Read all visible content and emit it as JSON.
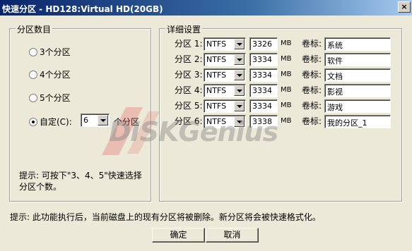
{
  "window": {
    "title": "快速分区 - HD128:Virtual HD(20GB)",
    "close_label": "×"
  },
  "left_group": {
    "title": "分区数目",
    "options": [
      {
        "label": "3个分区",
        "checked": false
      },
      {
        "label": "4个分区",
        "checked": false
      },
      {
        "label": "5个分区",
        "checked": false
      },
      {
        "label": "自定(C):",
        "checked": true
      }
    ],
    "custom_count": "6",
    "custom_suffix": "个分区",
    "hint_line1": "提示: 可按下\"3、4、5\"快速选择",
    "hint_line2": "分区个数。"
  },
  "right_group": {
    "title": "详细设置",
    "unit": "MB",
    "volume_label": "卷标:",
    "partitions": [
      {
        "label": "分区 1:",
        "fs": "NTFS",
        "size": "3326",
        "name": "系统"
      },
      {
        "label": "分区 2:",
        "fs": "NTFS",
        "size": "3334",
        "name": "软件"
      },
      {
        "label": "分区 3:",
        "fs": "NTFS",
        "size": "3334",
        "name": "文档"
      },
      {
        "label": "分区 4:",
        "fs": "NTFS",
        "size": "3334",
        "name": "影视"
      },
      {
        "label": "分区 5:",
        "fs": "NTFS",
        "size": "3334",
        "name": "游戏"
      },
      {
        "label": "分区 6:",
        "fs": "NTFS",
        "size": "3338",
        "name": "我的分区_1"
      }
    ]
  },
  "footer": {
    "warning": "提示: 此功能执行后，当前磁盘上的现有分区将被删除。新分区将会被快速格式化。",
    "ok_label": "确定",
    "cancel_label": "取消"
  },
  "watermark": {
    "text": "DISKGenius"
  }
}
